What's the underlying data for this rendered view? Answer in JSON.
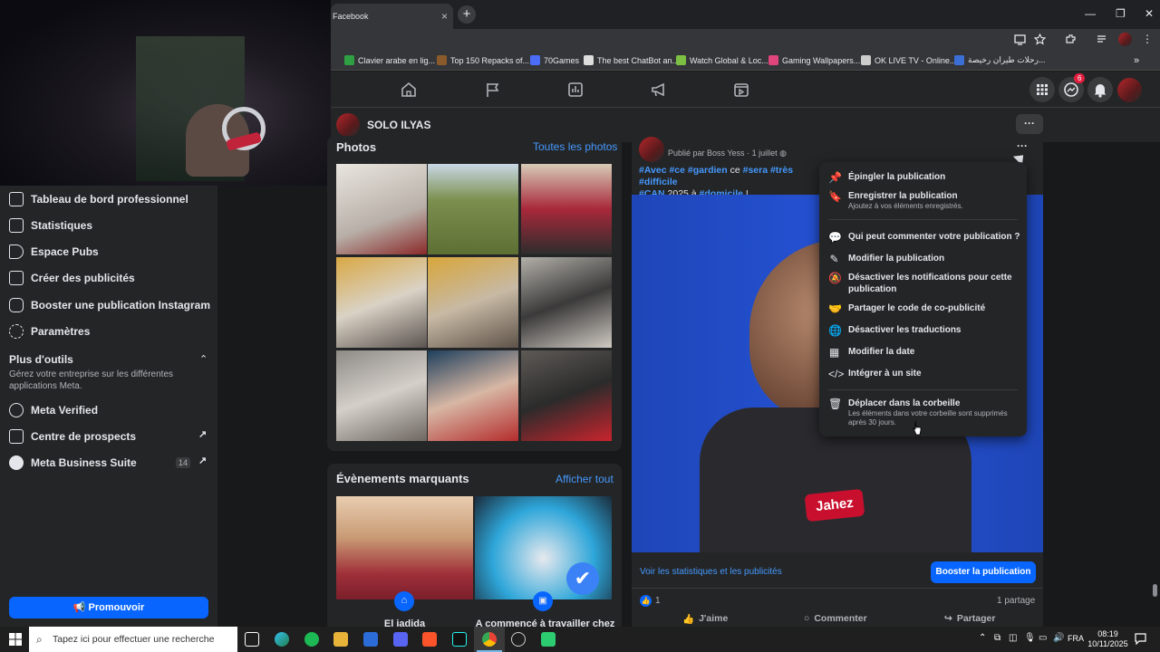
{
  "browser": {
    "tab_title": "Facebook",
    "tab_close": "×",
    "new_tab": "+",
    "bookmarks": [
      {
        "label": "Clavier arabe en lig...",
        "color": "#2ea043"
      },
      {
        "label": "Top 150 Repacks of...",
        "color": "#8b5a2b"
      },
      {
        "label": "70Games",
        "color": "#4a6cf7"
      },
      {
        "label": "The best ChatBot an...",
        "color": "#dddddd"
      },
      {
        "label": "Watch Global & Loc...",
        "color": "#7bc043"
      },
      {
        "label": "Gaming Wallpapers...",
        "color": "#e0457b"
      },
      {
        "label": "OK LIVE TV - Online...",
        "color": "#cccccc"
      },
      {
        "label": "رحلات طيران رخيصة...",
        "color": "#3b6fd6"
      }
    ],
    "more_bookmarks": "»"
  },
  "fbnav": {
    "messenger_badge": "6"
  },
  "page": {
    "name": "SOLO ILYAS",
    "more": "···"
  },
  "sidebar": {
    "items": [
      {
        "label": "Tableau de bord professionnel",
        "icon": "dashboard-icon"
      },
      {
        "label": "Statistiques",
        "icon": "chart-icon"
      },
      {
        "label": "Espace Pubs",
        "icon": "megaphone-icon"
      },
      {
        "label": "Créer des publicités",
        "icon": "pencil-icon"
      },
      {
        "label": "Booster une publication Instagram",
        "icon": "instagram-icon"
      },
      {
        "label": "Paramètres",
        "icon": "gear-icon"
      }
    ],
    "more_tools_title": "Plus d'outils",
    "more_tools_desc": "Gérez votre entreprise sur les différentes applications Meta.",
    "tools": [
      {
        "label": "Meta Verified",
        "badge": "",
        "arrow": ""
      },
      {
        "label": "Centre de prospects",
        "badge": "",
        "arrow": "↗"
      },
      {
        "label": "Meta Business Suite",
        "badge": "14",
        "arrow": "↗"
      }
    ],
    "promote": "📢 Promouvoir"
  },
  "photos": {
    "title": "Photos",
    "see_all": "Toutes les photos"
  },
  "events": {
    "title": "Évènements marquants",
    "see_all": "Afficher tout",
    "item1": "El jadida",
    "item2": "A commencé à travailler chez"
  },
  "post": {
    "author_line": "Publié par Boss Yess",
    "date": "1 juillet",
    "line1_pre": "#Avec #ce #gardien",
    "line1_mid": " ce ",
    "line1_tags": "#sera #très #difficile",
    "line2_tag": "#CAN",
    "line2_mid": " 2025 à ",
    "line2_tag2": "#domicile",
    "line2_end": " !",
    "jersey_text": "Jahez",
    "stats_link": "Voir les statistiques et les publicités",
    "boost_button": "Booster la publication",
    "reactions_count": "1",
    "shares": "1 partage",
    "like": "J'aime",
    "comment": "Commenter",
    "share": "Partager"
  },
  "menu": {
    "items": [
      {
        "label": "Épingler la publication",
        "sub": "",
        "icon": "pin-icon"
      },
      {
        "label": "Enregistrer la publication",
        "sub": "Ajoutez à vos éléments enregistrés.",
        "icon": "bookmark-icon"
      },
      {
        "label": "Qui peut commenter votre publication ?",
        "sub": "",
        "icon": "comment-icon"
      },
      {
        "label": "Modifier la publication",
        "sub": "",
        "icon": "pencil-icon"
      },
      {
        "label": "Désactiver les notifications pour cette publication",
        "sub": "",
        "icon": "bell-off-icon"
      },
      {
        "label": "Partager le code de co-publicité",
        "sub": "",
        "icon": "handshake-icon"
      },
      {
        "label": "Désactiver les traductions",
        "sub": "",
        "icon": "globe-icon"
      },
      {
        "label": "Modifier la date",
        "sub": "",
        "icon": "calendar-icon"
      },
      {
        "label": "Intégrer à un site",
        "sub": "",
        "icon": "code-icon"
      },
      {
        "label": "Déplacer dans la corbeille",
        "sub": "Les éléments dans votre corbeille sont supprimés après 30 jours.",
        "icon": "trash-icon"
      }
    ]
  },
  "taskbar": {
    "search_placeholder": "Tapez ici pour effectuer une recherche",
    "lang": "FRA",
    "time": "08:19",
    "date": "10/11/2025"
  }
}
